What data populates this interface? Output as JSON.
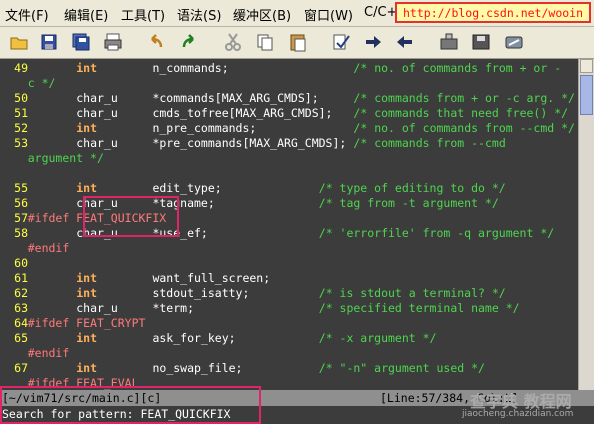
{
  "menu": [
    "文件(F)",
    "编辑(E)",
    "工具(T)",
    "语法(S)",
    "缓冲区(B)",
    "窗口(W)",
    "C/C+"
  ],
  "url": "http://blog.csdn.net/wooin",
  "toolbar": [
    "open-folder-icon",
    "save-icon",
    "save-all-icon",
    "print-icon",
    "undo-icon",
    "redo-icon",
    "cut-icon",
    "copy-icon",
    "paste-icon",
    "find-replace-icon",
    "forward-icon",
    "back-icon",
    "load-session-icon",
    "save-session-icon",
    "run-script-icon"
  ],
  "lines": [
    {
      "num": "49",
      "parts": [
        {
          "c": "kw",
          "x": 8,
          "t": "int"
        },
        {
          "c": "id",
          "x": 19,
          "t": "n_commands;"
        },
        {
          "c": "cm",
          "x": 48,
          "t": "/* no. of commands from + or -"
        }
      ]
    },
    {
      "num": "",
      "parts": [
        {
          "c": "cm",
          "x": 1,
          "t": "c */"
        }
      ]
    },
    {
      "num": "50",
      "parts": [
        {
          "c": "ty",
          "x": 8,
          "t": "char_u"
        },
        {
          "c": "id",
          "x": 19,
          "t": "*commands[MAX_ARG_CMDS];"
        },
        {
          "c": "cm",
          "x": 48,
          "t": "/* commands from + or -c arg. */"
        }
      ]
    },
    {
      "num": "51",
      "parts": [
        {
          "c": "ty",
          "x": 8,
          "t": "char_u"
        },
        {
          "c": "id",
          "x": 19,
          "t": "cmds_tofree[MAX_ARG_CMDS];"
        },
        {
          "c": "cm",
          "x": 48,
          "t": "/* commands that need free() */"
        }
      ]
    },
    {
      "num": "52",
      "parts": [
        {
          "c": "kw",
          "x": 8,
          "t": "int"
        },
        {
          "c": "id",
          "x": 19,
          "t": "n_pre_commands;"
        },
        {
          "c": "cm",
          "x": 48,
          "t": "/* no. of commands from --cmd */"
        }
      ]
    },
    {
      "num": "53",
      "parts": [
        {
          "c": "ty",
          "x": 8,
          "t": "char_u"
        },
        {
          "c": "id",
          "x": 19,
          "t": "*pre_commands[MAX_ARG_CMDS];"
        },
        {
          "c": "cm",
          "x": 48,
          "t": "/* commands from --cmd"
        }
      ]
    },
    {
      "num": "",
      "parts": [
        {
          "c": "cm",
          "x": 1,
          "t": "argument */"
        }
      ]
    },
    {
      "num": "",
      "parts": []
    },
    {
      "num": "55",
      "parts": [
        {
          "c": "kw",
          "x": 8,
          "t": "int"
        },
        {
          "c": "id",
          "x": 19,
          "t": "edit_type;"
        },
        {
          "c": "cm",
          "x": 43,
          "t": "/* type of editing to do */"
        }
      ]
    },
    {
      "num": "56",
      "parts": [
        {
          "c": "ty",
          "x": 8,
          "t": "char_u"
        },
        {
          "c": "id",
          "x": 19,
          "t": "*tagname;"
        },
        {
          "c": "cm",
          "x": 43,
          "t": "/* tag from -t argument */"
        }
      ]
    },
    {
      "num": "57",
      "parts": [
        {
          "c": "pp",
          "x": 1,
          "t": "#ifdef FEAT_QUICKFIX"
        }
      ]
    },
    {
      "num": "58",
      "parts": [
        {
          "c": "ty",
          "x": 8,
          "t": "char_u"
        },
        {
          "c": "id",
          "x": 19,
          "t": "*use_ef;"
        },
        {
          "c": "cm",
          "x": 43,
          "t": "/* 'errorfile' from -q argument */"
        }
      ]
    },
    {
      "num": "",
      "parts": [
        {
          "c": "pp",
          "x": 1,
          "t": "#endif"
        }
      ]
    },
    {
      "num": "60",
      "parts": []
    },
    {
      "num": "61",
      "parts": [
        {
          "c": "kw",
          "x": 8,
          "t": "int"
        },
        {
          "c": "id",
          "x": 19,
          "t": "want_full_screen;"
        }
      ]
    },
    {
      "num": "62",
      "parts": [
        {
          "c": "kw",
          "x": 8,
          "t": "int"
        },
        {
          "c": "id",
          "x": 19,
          "t": "stdout_isatty;"
        },
        {
          "c": "cm",
          "x": 43,
          "t": "/* is stdout a terminal? */"
        }
      ]
    },
    {
      "num": "63",
      "parts": [
        {
          "c": "ty",
          "x": 8,
          "t": "char_u"
        },
        {
          "c": "id",
          "x": 19,
          "t": "*term;"
        },
        {
          "c": "cm",
          "x": 43,
          "t": "/* specified terminal name */"
        }
      ]
    },
    {
      "num": "64",
      "parts": [
        {
          "c": "pp",
          "x": 1,
          "t": "#ifdef FEAT_CRYPT"
        }
      ]
    },
    {
      "num": "65",
      "parts": [
        {
          "c": "kw",
          "x": 8,
          "t": "int"
        },
        {
          "c": "id",
          "x": 19,
          "t": "ask_for_key;"
        },
        {
          "c": "cm",
          "x": 43,
          "t": "/* -x argument */"
        }
      ]
    },
    {
      "num": "",
      "parts": [
        {
          "c": "pp",
          "x": 1,
          "t": "#endif"
        }
      ]
    },
    {
      "num": "67",
      "parts": [
        {
          "c": "kw",
          "x": 8,
          "t": "int"
        },
        {
          "c": "id",
          "x": 19,
          "t": "no_swap_file;"
        },
        {
          "c": "cm",
          "x": 43,
          "t": "/* \"-n\" argument used */"
        }
      ]
    },
    {
      "num": "",
      "parts": [
        {
          "c": "pp",
          "x": 1,
          "t": "#ifdef FEAT_EVAL"
        }
      ]
    }
  ],
  "status": {
    "file": "[~/vim71/src/main.c][c]",
    "position": "[Line:57/384, Col:1]"
  },
  "cmdline": "Search for pattern: FEAT_QUICKFIX",
  "watermark": {
    "main": "查字典 教程网",
    "sub": "jiaocheng.chazidian.com"
  }
}
